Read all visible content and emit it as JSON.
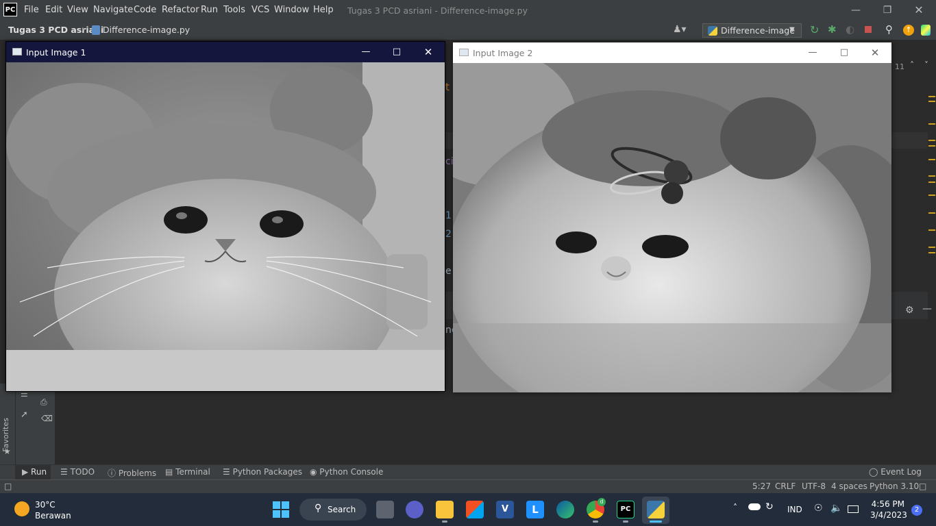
{
  "app": {
    "logo": "PC",
    "menu": [
      "File",
      "Edit",
      "View",
      "Navigate",
      "Code",
      "Refactor",
      "Run",
      "Tools",
      "VCS",
      "Window",
      "Help"
    ],
    "window_title": "Tugas 3 PCD asriani - Difference-image.py"
  },
  "navbar": {
    "project": "Tugas 3 PCD asriani",
    "file": "Difference-image.py",
    "run_config": "Difference-image"
  },
  "editor": {
    "fragments": [
      "t",
      "ci",
      "ci",
      "1",
      "2",
      "e",
      "nc"
    ],
    "line_counter": "11"
  },
  "windows": [
    {
      "title": "Input Image 1"
    },
    {
      "title": "Input Image 2"
    }
  ],
  "tool_tabs": [
    "Run",
    "TODO",
    "Problems",
    "Terminal",
    "Python Packages",
    "Python Console"
  ],
  "event_log": "Event Log",
  "favorites_label": "Favorites",
  "status": {
    "position": "5:27",
    "line_sep": "CRLF",
    "encoding": "UTF-8",
    "indent": "4 spaces",
    "interpreter": "Python 3.10"
  },
  "taskbar": {
    "weather_temp": "30°C",
    "weather_desc": "Berawan",
    "search_label": "Search",
    "language": "IND",
    "time": "4:56 PM",
    "date": "3/4/2023",
    "notif_count": "2",
    "chrome_badge": "d"
  },
  "colors": {
    "ide_bg": "#2b2b2b",
    "ide_panel": "#3c3f41",
    "win1_title": "#15163d",
    "taskbar": "#222c3a",
    "marker": "#d2a11e"
  }
}
